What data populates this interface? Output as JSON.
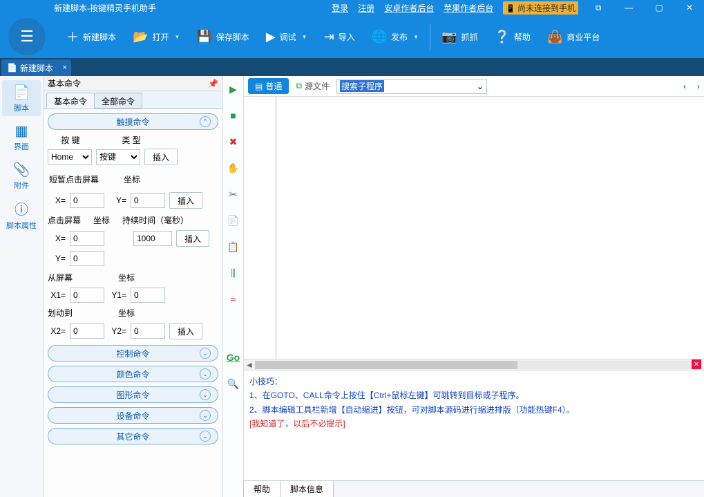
{
  "titlebar": {
    "title": "新建脚本-按键精灵手机助手",
    "links": {
      "login": "登录",
      "register": "注册",
      "android_dev": "安卓作者后台",
      "ios_dev": "苹果作者后台"
    },
    "status": "尚未连接到手机"
  },
  "toolbar": {
    "new_script": "新建脚本",
    "open": "打开",
    "save": "保存脚本",
    "debug": "调试",
    "import": "导入",
    "publish": "发布",
    "capture": "抓抓",
    "help": "帮助",
    "market": "商业平台"
  },
  "tab": {
    "name": "新建脚本"
  },
  "leftbar": {
    "script": "脚本",
    "ui": "界面",
    "attach": "附件",
    "props": "脚本属性"
  },
  "cmdpanel": {
    "title": "基本命令",
    "tab_basic": "基本命令",
    "tab_all": "全部命令",
    "groups": {
      "touch": "触摸命令",
      "control": "控制命令",
      "color": "颜色命令",
      "graphic": "图形命令",
      "device": "设备命令",
      "other": "其它命令"
    },
    "key_label": "按 键",
    "type_label": "类 型",
    "key_value": "Home",
    "type_value": "按键",
    "insert": "插入",
    "tap_short": "短暂点击屏幕",
    "coord": "坐标",
    "x_eq": "X=",
    "y_eq": "Y=",
    "x1_eq": "X1=",
    "y1_eq": "Y1=",
    "x2_eq": "X2=",
    "y2_eq": "Y2=",
    "tap_label": "点击屏幕",
    "duration": "持续时间（毫秒）",
    "dur_value": "1000",
    "from_screen": "从屏幕",
    "slide_to": "划动到",
    "zero": "0"
  },
  "editor": {
    "mode_normal": "普通",
    "source": "源文件",
    "search_placeholder": "搜索子程序",
    "nav_left": "‹",
    "nav_right": "›"
  },
  "tips": {
    "title": "小技巧：",
    "line1": "1、在GOTO、CALL命令上按住【Ctrl+鼠标左键】可跳转到目标或子程序。",
    "line2": "2、脚本编辑工具栏新增【自动缩进】按钮，可对脚本源码进行缩进排版（功能热键F4）。",
    "dismiss": "[我知道了，以后不必提示]"
  },
  "bottomtabs": {
    "help": "帮助",
    "info": "脚本信息"
  },
  "vtool": {
    "run": "▶",
    "stop": "■",
    "del": "✖",
    "hand": "✋",
    "cut": "✂",
    "copy": "📄",
    "paste": "📋",
    "indent": "⫼",
    "comment": "≈",
    "go": "Go",
    "find": "🔍"
  }
}
